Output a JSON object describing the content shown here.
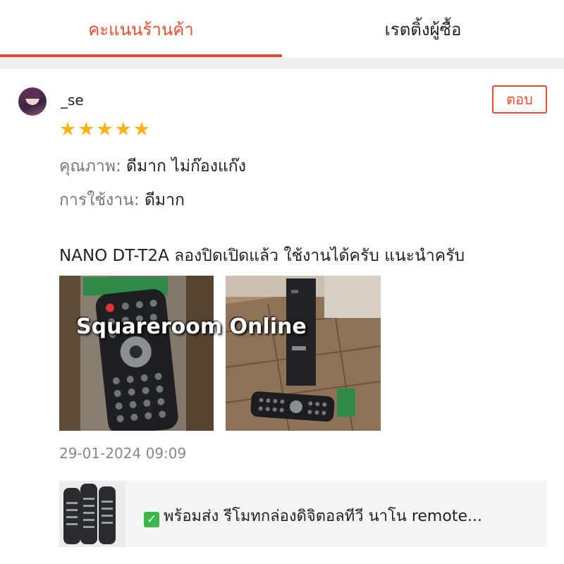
{
  "tabs": [
    {
      "label": "คะแนนร้านค้า",
      "active": true
    },
    {
      "label": "เรตติ้งผู้ซื้อ",
      "active": false
    }
  ],
  "review": {
    "username": "_se",
    "reply_label": "ตอบ",
    "rating": 5,
    "quality_key": "คุณภาพ:",
    "quality_value": "ดีมาก ไม่ก๊องแก๊ง",
    "usage_key": "การใช้งาน:",
    "usage_value": "ดีมาก",
    "comment": "NANO DT-T2A ลองปิดเปิดแล้ว ใช้งานได้ครับ แนะนำครับ",
    "watermark": "Squareroom Online",
    "datetime": "29-01-2024 09:09"
  },
  "product": {
    "title": "พร้อมส่ง รีโมทกล่องดิจิตอลทีวี นาโน remote..."
  },
  "colors": {
    "accent": "#ee4d2d",
    "star": "#ffb116",
    "check": "#3bb84a"
  }
}
